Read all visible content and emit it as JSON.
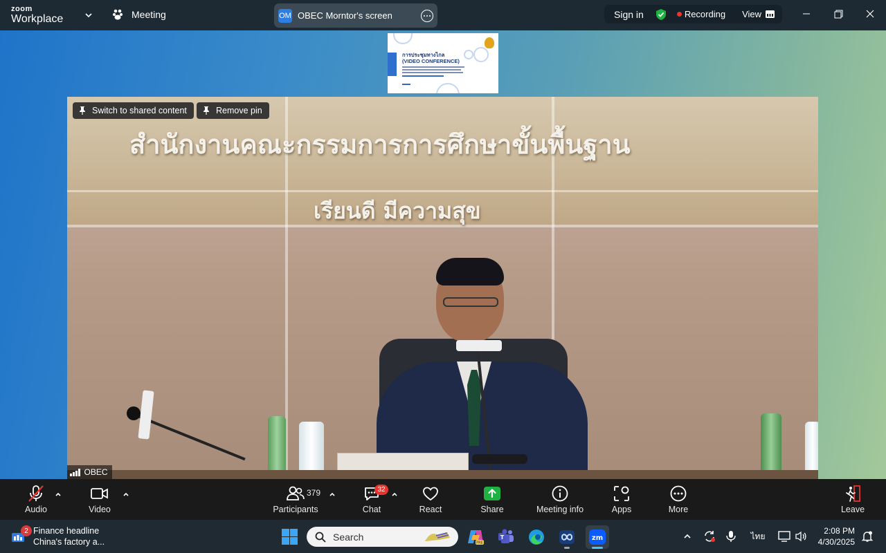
{
  "titlebar": {
    "brand_top": "zoom",
    "brand_bottom": "Workplace",
    "meeting_label": "Meeting",
    "share_avatar": "OM",
    "share_title": "OBEC Morntor's screen",
    "sign_in": "Sign in",
    "recording": "Recording",
    "view": "View"
  },
  "stage": {
    "thumbnail": {
      "line1": "การประชุมทางไกล",
      "line2": "(VIDEO CONFERENCE)"
    },
    "video": {
      "sign_line1": "สำนักงานคณะกรรมการการศึกษาขั้นพื้นฐาน",
      "sign_line2": "เรียนดี มีความสุข",
      "switch_button": "Switch to shared content",
      "remove_pin": "Remove pin",
      "participant_name": "OBEC"
    }
  },
  "toolbar": {
    "audio": "Audio",
    "video": "Video",
    "participants": "Participants",
    "participants_count": "379",
    "chat": "Chat",
    "chat_badge": "32",
    "react": "React",
    "share": "Share",
    "meeting_info": "Meeting info",
    "apps": "Apps",
    "more": "More",
    "leave": "Leave"
  },
  "taskbar": {
    "news_badge": "2",
    "news_title": "Finance headline",
    "news_sub": "China's factory a...",
    "search_placeholder": "Search",
    "language": "ไทย",
    "time": "2:08 PM",
    "date": "4/30/2025"
  },
  "colors": {
    "accent_green": "#1fb141",
    "record_red": "#e8352e",
    "zoom_blue": "#0b5cff"
  }
}
